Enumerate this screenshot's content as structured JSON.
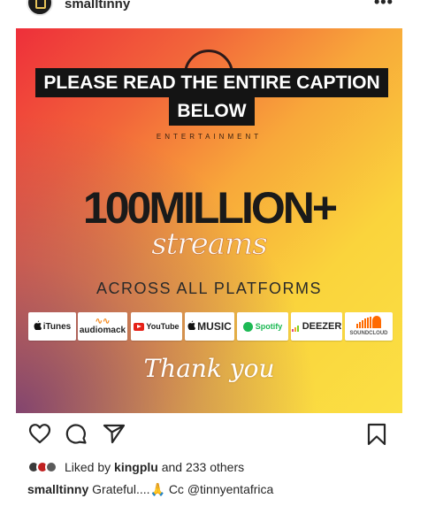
{
  "header": {
    "username": "smalltinny",
    "more_label": "•••"
  },
  "post": {
    "notice_line1": "PLEASE READ THE ENTIRE CAPTION",
    "notice_line2": "BELOW",
    "label_entertainment": "ENTERTAINMENT",
    "headline": "100MILLION+",
    "headline_sub": "streams",
    "subheadline": "ACROSS ALL PLATFORMS",
    "platforms": {
      "itunes": "iTunes",
      "audiomack": "audiomack",
      "youtube": "YouTube",
      "music": "MUSIC",
      "spotify": "Spotify",
      "deezer": "DEEZER",
      "soundcloud": "SOUNDCLOUD"
    },
    "closing": "Thank you"
  },
  "engagement": {
    "liked_prefix": "Liked by",
    "liked_user": "kingplu",
    "liked_suffix": "and 233 others"
  },
  "caption": {
    "username": "smalltinny",
    "text": "Grateful....🙏 Cc",
    "mention": "@tinnyentafrica"
  },
  "colors": {
    "accent_red": "#ee2f3a",
    "accent_orange": "#f8a83a",
    "accent_yellow": "#fbe044",
    "notice_bg": "#141414"
  },
  "icons": [
    "heart-icon",
    "comment-icon",
    "share-icon",
    "bookmark-icon",
    "apple-icon"
  ]
}
